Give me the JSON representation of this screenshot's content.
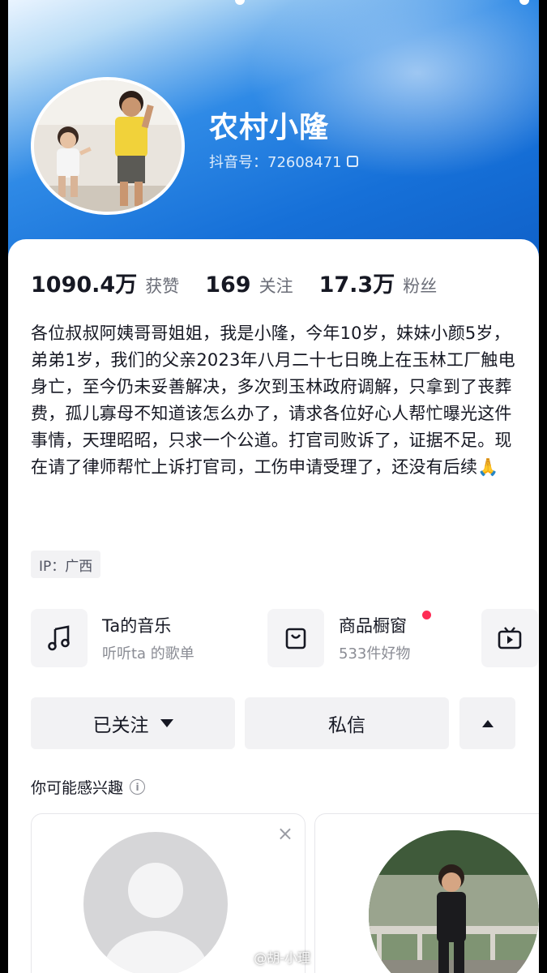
{
  "profile": {
    "name": "农村小隆",
    "douyin_id": "抖音号：72608471",
    "ip": "IP：广西"
  },
  "stats": [
    {
      "num": "1090.4万",
      "label": "获赞"
    },
    {
      "num": "169",
      "label": "关注"
    },
    {
      "num": "17.3万",
      "label": "粉丝"
    }
  ],
  "bio": "各位叔叔阿姨哥哥姐姐，我是小隆，今年10岁，妹妹小颜5岁，弟弟1岁，我们的父亲2023年八月二十七日晚上在玉林工厂触电身亡，至今仍未妥善解决，多次到玉林政府调解，只拿到了丧葬费，孤儿寡母不知道该怎么办了，请求各位好心人帮忙曝光这件事情，天理昭昭，只求一个公道。打官司败诉了，证据不足。现在请了律师帮忙上诉打官司，工伤申请受理了，还没有后续🙏",
  "features": {
    "music": {
      "title": "Ta的音乐",
      "sub": "听听ta 的歌单",
      "icon": "music-note-icon"
    },
    "shop": {
      "title": "商品橱窗",
      "sub": "533件好物",
      "icon": "shopping-bag-icon"
    },
    "tv": {
      "icon": "tv-play-icon"
    }
  },
  "buttons": {
    "followed": "已关注",
    "message": "私信"
  },
  "recommend": {
    "title": "你可能感兴趣",
    "close": "×"
  },
  "watermark": "@胡-小理",
  "colors": {
    "accent_red": "#fe2c55",
    "header_blue": "#1670d8"
  }
}
